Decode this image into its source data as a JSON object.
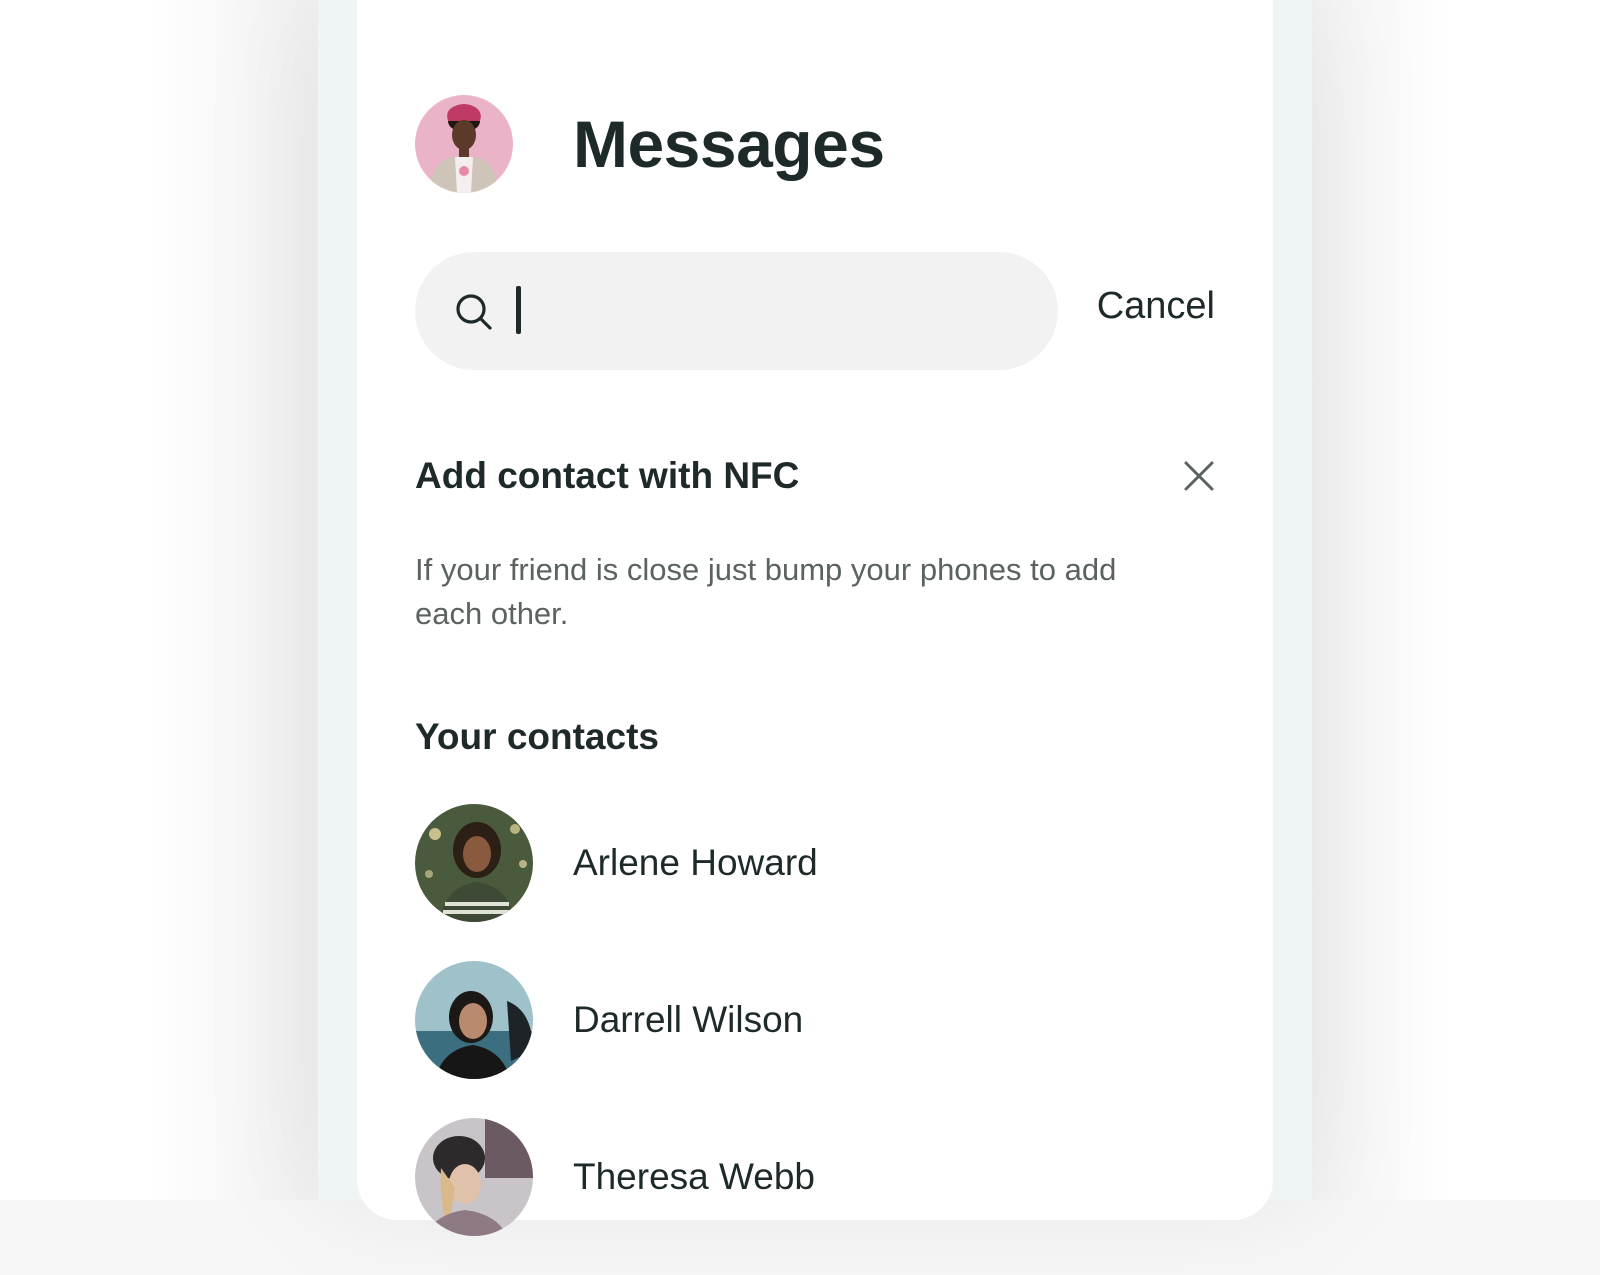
{
  "header": {
    "title": "Messages",
    "profile_avatar": "profile-photo"
  },
  "search": {
    "value": "",
    "placeholder": "",
    "icon": "search-icon",
    "cancel_label": "Cancel"
  },
  "nfc": {
    "title": "Add contact with NFC",
    "description": "If your friend is close just bump your phones to add each other.",
    "close_icon": "close-icon"
  },
  "contacts": {
    "title": "Your contacts",
    "items": [
      {
        "name": "Arlene Howard"
      },
      {
        "name": "Darrell Wilson"
      },
      {
        "name": "Theresa Webb"
      }
    ]
  },
  "colors": {
    "text_primary": "#1e2a2a",
    "text_secondary": "#5b6262",
    "search_bg": "#f2f2f2",
    "device_frame": "#eef5f4"
  }
}
